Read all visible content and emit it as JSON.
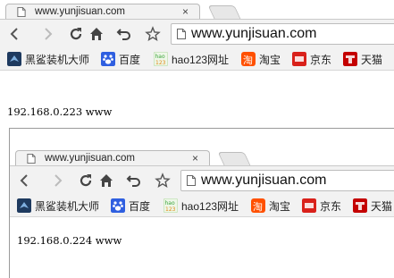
{
  "windows": [
    {
      "tab_title": "www.yunjisuan.com",
      "tab_close": "×",
      "url": "www.yunjisuan.com",
      "bookmarks": [
        {
          "label": "黑鲨装机大师",
          "icon": "blackshark-icon"
        },
        {
          "label": "百度",
          "icon": "baidu-paw-icon"
        },
        {
          "label": "hao123网址",
          "icon": "hao123-icon"
        },
        {
          "label": "淘宝",
          "icon": "taobao-icon"
        },
        {
          "label": "京东",
          "icon": "jd-icon"
        },
        {
          "label": "天猫",
          "icon": "tmall-icon"
        }
      ],
      "page_text": "192.168.0.223 www"
    },
    {
      "tab_title": "www.yunjisuan.com",
      "tab_close": "×",
      "url": "www.yunjisuan.com",
      "bookmarks": [
        {
          "label": "黑鲨装机大师",
          "icon": "blackshark-icon"
        },
        {
          "label": "百度",
          "icon": "baidu-paw-icon"
        },
        {
          "label": "hao123网址",
          "icon": "hao123-icon"
        },
        {
          "label": "淘宝",
          "icon": "taobao-icon"
        },
        {
          "label": "京东",
          "icon": "jd-icon"
        },
        {
          "label": "天猫",
          "icon": "tmall-icon"
        }
      ],
      "page_text": "192.168.0.224 www"
    }
  ],
  "icon_colors": {
    "blackshark": "#1e3a5f",
    "baidu": "#2f5fe0",
    "hao123": "#3aa33a",
    "taobao": "#ff5000",
    "jd": "#d9211b",
    "tmall": "#c40000"
  }
}
